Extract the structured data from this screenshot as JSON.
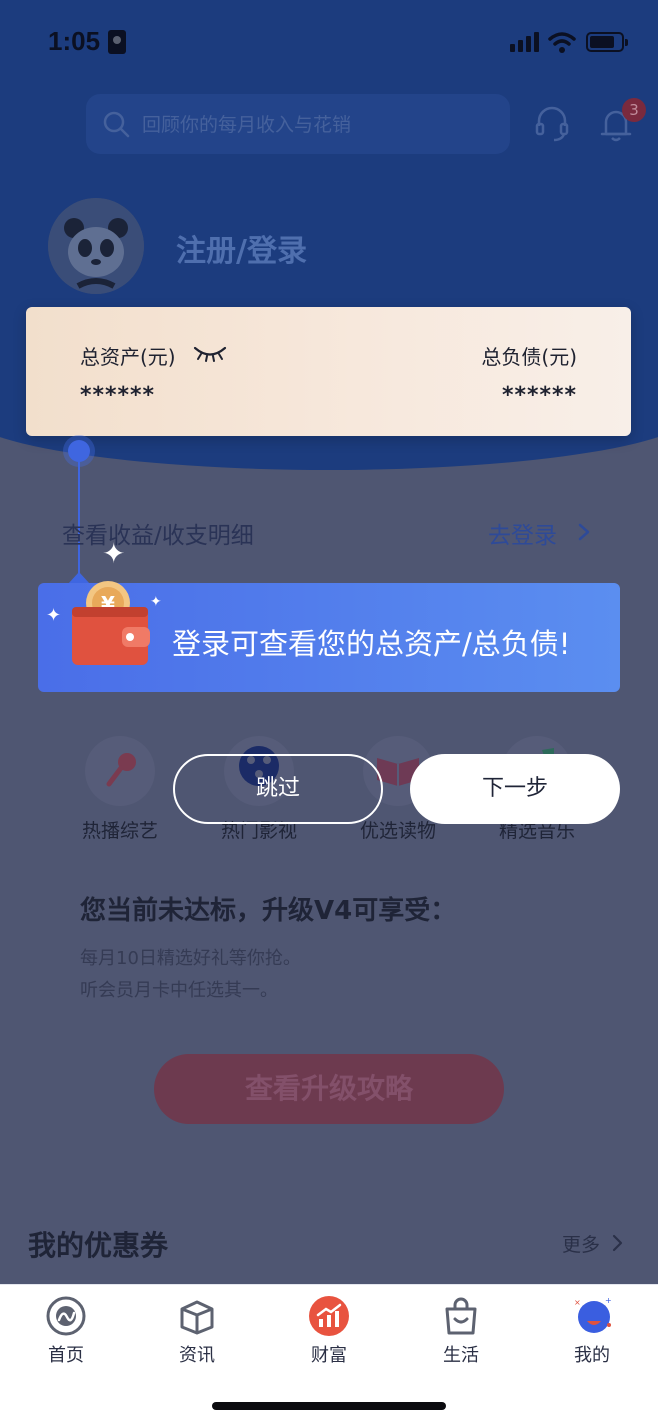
{
  "status_bar": {
    "time": "1:05"
  },
  "header": {
    "search_placeholder": "回顾你的每月收入与花销",
    "notification_count": "3",
    "login_title": "注册/登录"
  },
  "asset_card": {
    "total_assets_label": "总资产(元)",
    "total_assets_value": "******",
    "total_liabilities_label": "总负债(元)",
    "total_liabilities_value": "******"
  },
  "detail_row": {
    "label": "查看收益/收支明细",
    "action": "去登录"
  },
  "guide": {
    "message": "登录可查看您的总资产/总负债!",
    "skip_label": "跳过",
    "next_label": "下一步"
  },
  "entries": [
    {
      "label": "热播综艺",
      "icon": "microphone-icon"
    },
    {
      "label": "热门影视",
      "icon": "film-reel-icon"
    },
    {
      "label": "优选读物",
      "icon": "book-icon"
    },
    {
      "label": "精选音乐",
      "icon": "music-icon"
    }
  ],
  "level": {
    "title": "您当前未达标，升级V4可享受：",
    "line1": "每月10日精选好礼等你抢。",
    "line2": "听会员月卡中任选其一。",
    "upgrade_button": "查看升级攻略"
  },
  "coupons": {
    "title": "我的优惠券",
    "more": "更多"
  },
  "tabbar": [
    {
      "label": "首页",
      "icon": "home-icon"
    },
    {
      "label": "资讯",
      "icon": "news-box-icon"
    },
    {
      "label": "财富",
      "icon": "wealth-chart-icon",
      "active": true
    },
    {
      "label": "生活",
      "icon": "shopping-bag-icon"
    },
    {
      "label": "我的",
      "icon": "profile-planet-icon"
    }
  ],
  "colors": {
    "header_blue": "#1c3c7e",
    "guide_blue": "#4a6ee8",
    "active_tab_red": "#e8533f",
    "overlay_gray": "#4f5672"
  }
}
